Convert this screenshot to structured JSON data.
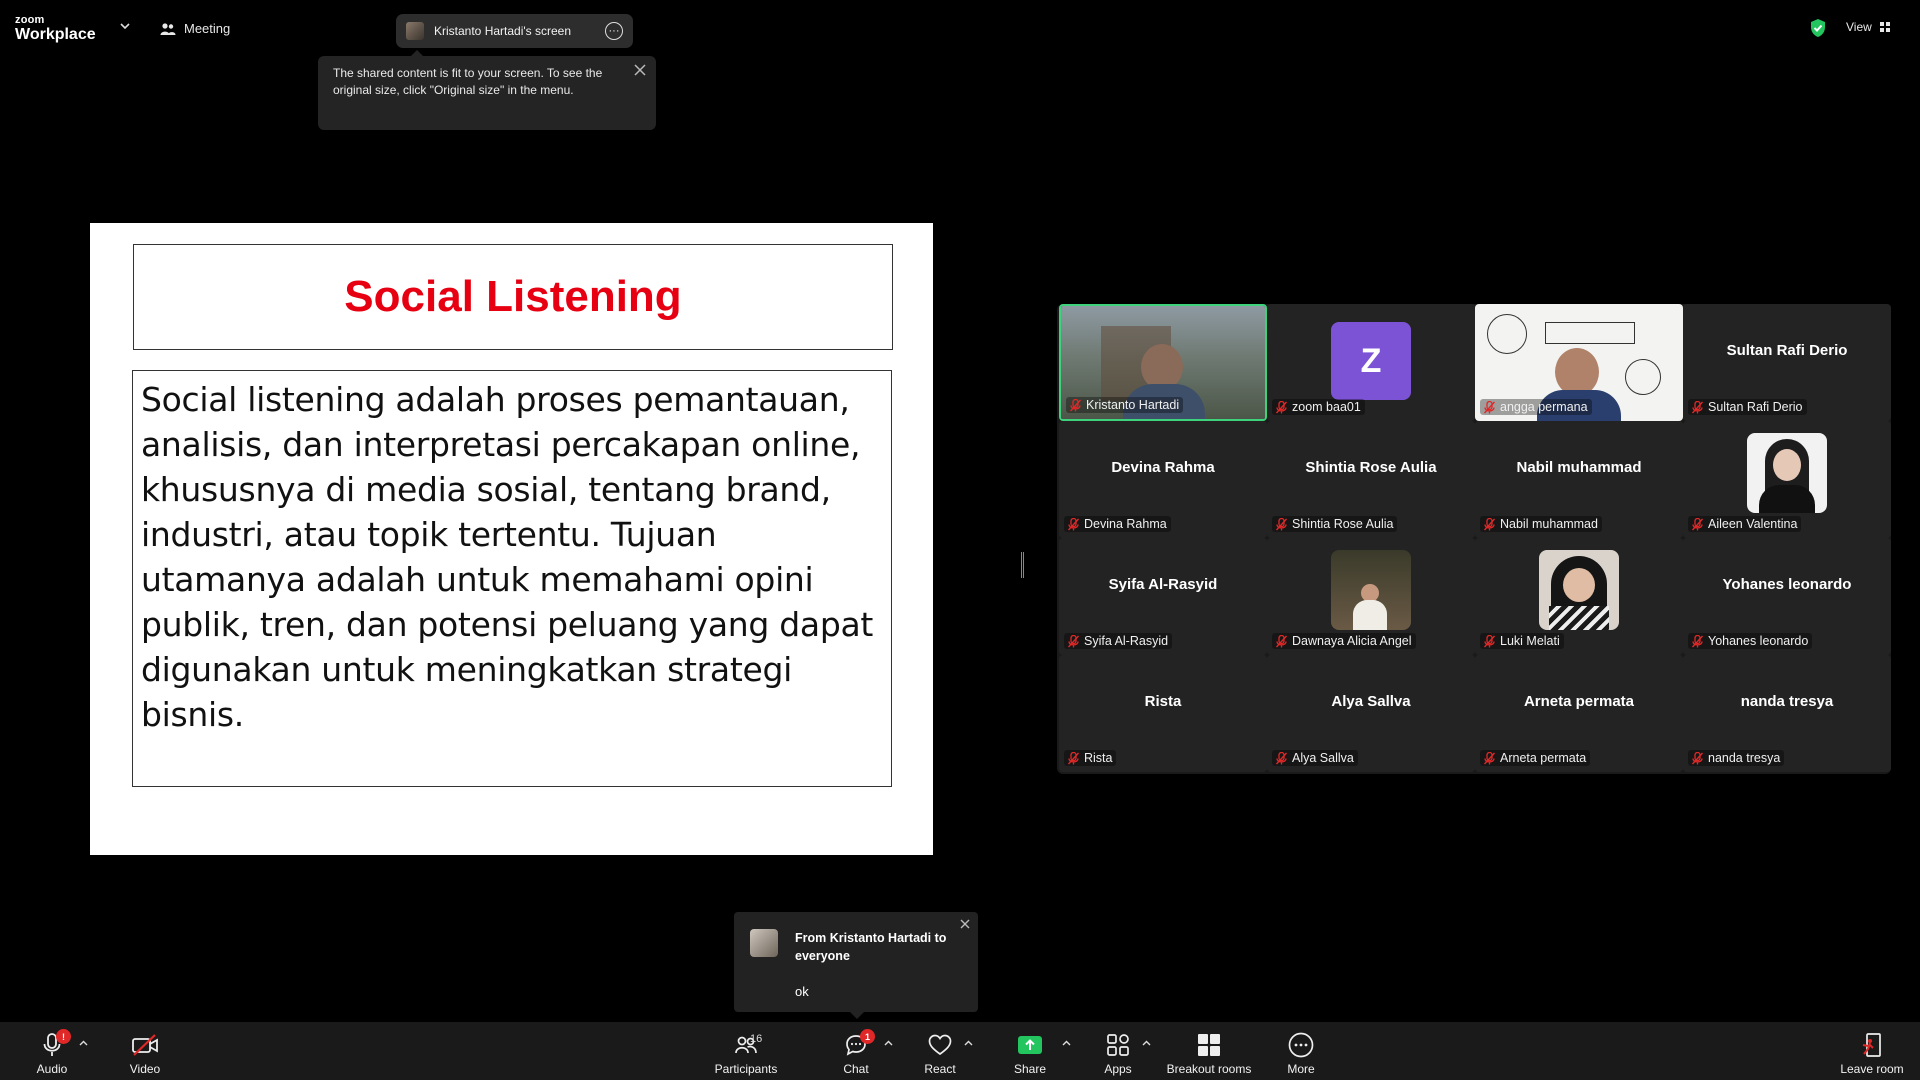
{
  "app": {
    "brand_top": "zoom",
    "brand_bottom": "Workplace",
    "meeting_label": "Meeting",
    "view_label": "View"
  },
  "share": {
    "title": "Kristanto Hartadi's screen"
  },
  "tooltip": {
    "text": "The shared content is fit to your screen. To see the original size, click \"Original size\" in the menu."
  },
  "slide": {
    "title": "Social Listening",
    "body": "Social listening adalah proses pemantauan, analisis, dan interpretasi percakapan online, khususnya di media sosial, tentang brand, industri, atau topik tertentu. Tujuan utamanya adalah untuk memahami opini publik, tren, dan potensi peluang yang dapat digunakan untuk meningkatkan strategi bisnis."
  },
  "participants": [
    {
      "name": "Kristanto Hartadi",
      "tile": "video",
      "active": true
    },
    {
      "name": "zoom baa01",
      "tile": "avatar",
      "initial": "Z"
    },
    {
      "name": "angga permana",
      "tile": "video"
    },
    {
      "name": "Sultan Rafi Derio",
      "tile": "name"
    },
    {
      "name": "Devina Rahma",
      "tile": "name"
    },
    {
      "name": "Shintia Rose Aulia",
      "tile": "name"
    },
    {
      "name": "Nabil muhammad",
      "tile": "name"
    },
    {
      "name": "Aileen Valentina",
      "tile": "photo"
    },
    {
      "name": "Syifa Al-Rasyid",
      "tile": "name"
    },
    {
      "name": "Dawnaya Alicia Angel",
      "tile": "photo"
    },
    {
      "name": "Luki Melati",
      "tile": "photo"
    },
    {
      "name": "Yohanes leonardo",
      "tile": "name"
    },
    {
      "name": "Rista",
      "tile": "name"
    },
    {
      "name": "Alya Sallva",
      "tile": "name"
    },
    {
      "name": "Arneta permata",
      "tile": "name"
    },
    {
      "name": "nanda tresya",
      "tile": "name"
    }
  ],
  "chat_toast": {
    "from": "From Kristanto Hartadi to everyone",
    "message": "ok"
  },
  "toolbar": {
    "audio": "Audio",
    "video": "Video",
    "participants": "Participants",
    "participants_count": "16",
    "chat": "Chat",
    "chat_badge": "1",
    "audio_badge": "!",
    "react": "React",
    "share": "Share",
    "apps": "Apps",
    "breakout": "Breakout rooms",
    "more": "More",
    "leave": "Leave room"
  },
  "colors": {
    "accent_green": "#3ed27c",
    "share_green": "#22c55e",
    "alert_red": "#e02828",
    "slide_title_red": "#e60012",
    "avatar_purple": "#7d53d6"
  }
}
